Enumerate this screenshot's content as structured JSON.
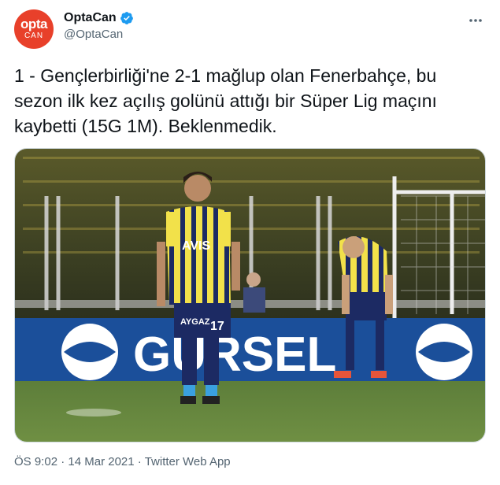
{
  "author": {
    "avatar_line1": "opta",
    "avatar_line2": "CAN",
    "display_name": "OptaCan",
    "handle": "@OptaCan",
    "verified_icon": "verified-badge-icon",
    "brand_color": "#e8402a",
    "verified_color": "#1d9bf0"
  },
  "tweet": {
    "text": "1 - Gençlerbirliği'ne 2-1 mağlup olan Fenerbahçe, bu sezon ilk kez açılış golünü attığı bir Süper Lig maçını kaybetti (15G 1M). Beklenmedik."
  },
  "media": {
    "shirt_sponsor": "AVIS",
    "shorts_sponsor": "AYGAZ",
    "shorts_number": "17",
    "board_text": "GÜRSEL"
  },
  "meta": {
    "time": "ÖS 9:02",
    "sep1": " · ",
    "date": "14 Mar 2021",
    "sep2": " · ",
    "source": "Twitter Web App"
  },
  "icons": {
    "more": "more-dots-icon"
  }
}
